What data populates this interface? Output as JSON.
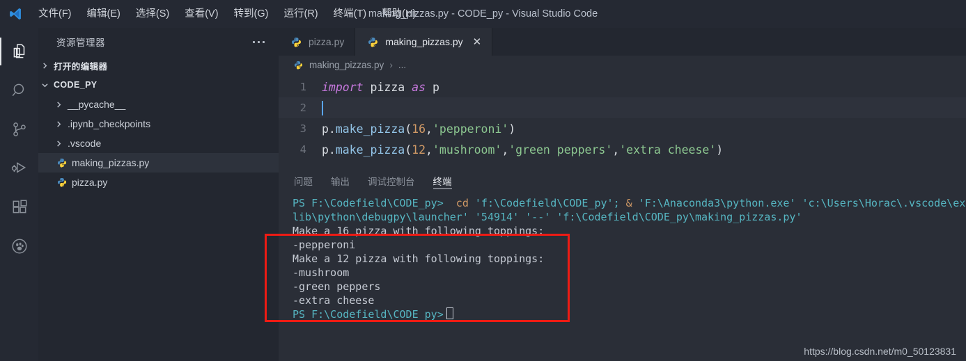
{
  "window": {
    "title": "making_pizzas.py - CODE_py - Visual Studio Code",
    "logo_icon": "vscode-logo-icon"
  },
  "menubar": {
    "items": [
      {
        "label": "文件(F)",
        "name": "menu-file"
      },
      {
        "label": "编辑(E)",
        "name": "menu-edit"
      },
      {
        "label": "选择(S)",
        "name": "menu-selection"
      },
      {
        "label": "查看(V)",
        "name": "menu-view"
      },
      {
        "label": "转到(G)",
        "name": "menu-go"
      },
      {
        "label": "运行(R)",
        "name": "menu-run"
      },
      {
        "label": "终端(T)",
        "name": "menu-terminal"
      },
      {
        "label": "帮助(H)",
        "name": "menu-help"
      }
    ]
  },
  "activitybar": {
    "items": [
      {
        "icon": "files-explorer-icon",
        "active": true
      },
      {
        "icon": "search-icon",
        "active": false
      },
      {
        "icon": "source-control-icon",
        "active": false
      },
      {
        "icon": "run-and-debug-icon",
        "active": false
      },
      {
        "icon": "extensions-icon",
        "active": false
      },
      {
        "icon": "paw-print-icon",
        "active": false
      }
    ]
  },
  "sidebar": {
    "title": "资源管理器",
    "more_actions_icon": "ellipsis-icon",
    "sections": [
      {
        "label": "打开的编辑器",
        "expanded": false,
        "name": "open-editors-section"
      },
      {
        "label": "CODE_PY",
        "expanded": true,
        "name": "workspace-folder-section"
      }
    ],
    "files": [
      {
        "label": "__pycache__",
        "type": "folder",
        "selected": false
      },
      {
        "label": ".ipynb_checkpoints",
        "type": "folder",
        "selected": false
      },
      {
        "label": ".vscode",
        "type": "folder",
        "selected": false
      },
      {
        "label": "making_pizzas.py",
        "type": "python",
        "selected": true
      },
      {
        "label": "pizza.py",
        "type": "python",
        "selected": false
      }
    ]
  },
  "editor": {
    "tabs": [
      {
        "label": "pizza.py",
        "active": false,
        "closable": false
      },
      {
        "label": "making_pizzas.py",
        "active": true,
        "closable": true,
        "close_label": "✕"
      }
    ],
    "breadcrumb": {
      "file": "making_pizzas.py",
      "separator": "›",
      "trailing": "..."
    },
    "lines": [
      {
        "number": "1",
        "current": false,
        "tokens": [
          {
            "text": "import",
            "type": "kw"
          },
          {
            "text": " pizza ",
            "type": "plain"
          },
          {
            "text": "as",
            "type": "kw"
          },
          {
            "text": " p",
            "type": "plain"
          }
        ]
      },
      {
        "number": "2",
        "current": true,
        "cursor": true,
        "tokens": []
      },
      {
        "number": "3",
        "current": false,
        "tokens": [
          {
            "text": "p.",
            "type": "plain"
          },
          {
            "text": "make_pizza",
            "type": "fn"
          },
          {
            "text": "(",
            "type": "punct"
          },
          {
            "text": "16",
            "type": "num"
          },
          {
            "text": ",",
            "type": "punct"
          },
          {
            "text": "'pepperoni'",
            "type": "str"
          },
          {
            "text": ")",
            "type": "punct"
          }
        ]
      },
      {
        "number": "4",
        "current": false,
        "tokens": [
          {
            "text": "p.",
            "type": "plain"
          },
          {
            "text": "make_pizza",
            "type": "fn"
          },
          {
            "text": "(",
            "type": "punct"
          },
          {
            "text": "12",
            "type": "num"
          },
          {
            "text": ",",
            "type": "punct"
          },
          {
            "text": "'mushroom'",
            "type": "str"
          },
          {
            "text": ",",
            "type": "punct"
          },
          {
            "text": "'green peppers'",
            "type": "str"
          },
          {
            "text": ",",
            "type": "punct"
          },
          {
            "text": "'extra cheese'",
            "type": "str"
          },
          {
            "text": ")",
            "type": "punct"
          }
        ]
      }
    ]
  },
  "panel": {
    "tabs": [
      {
        "label": "问题",
        "active": false,
        "name": "tab-problems"
      },
      {
        "label": "输出",
        "active": false,
        "name": "tab-output"
      },
      {
        "label": "调试控制台",
        "active": false,
        "name": "tab-debug-console"
      },
      {
        "label": "终端",
        "active": true,
        "name": "tab-terminal"
      }
    ],
    "terminal": {
      "lines": [
        {
          "type": "command",
          "segments": [
            {
              "text": "PS F:\\Codefield\\CODE_py> ",
              "cls": "t-prompt"
            },
            {
              "text": " cd ",
              "cls": "t-cmd"
            },
            {
              "text": "'f:\\Codefield\\CODE_py'",
              "cls": "t-path"
            },
            {
              "text": "; ",
              "cls": "t-path"
            },
            {
              "text": "& ",
              "cls": "t-amp"
            },
            {
              "text": "'F:\\Anaconda3\\python.exe' 'c:\\Users\\Horac\\.vscode\\ex",
              "cls": "t-path"
            }
          ]
        },
        {
          "type": "command",
          "segments": [
            {
              "text": "lib\\python\\debugpy\\launcher' '54914' '--' 'f:\\Codefield\\CODE_py\\making_pizzas.py'",
              "cls": "t-path"
            }
          ]
        },
        {
          "type": "output",
          "text": "Make a 16 pizza with following toppings:"
        },
        {
          "type": "output",
          "text": "-pepperoni"
        },
        {
          "type": "output",
          "text": "Make a 12 pizza with following toppings:"
        },
        {
          "type": "output",
          "text": "-mushroom"
        },
        {
          "type": "output",
          "text": "-green peppers"
        },
        {
          "type": "output",
          "text": "-extra cheese"
        },
        {
          "type": "prompt",
          "segments": [
            {
              "text": "PS F:\\Codefield\\CODE_py>",
              "cls": "t-prompt"
            }
          ],
          "cursor": true
        }
      ]
    }
  },
  "annotation": {
    "highlight_color": "#ee1b14",
    "name": "red-highlight-box"
  },
  "watermark": {
    "text": "https://blog.csdn.net/m0_50123831"
  }
}
